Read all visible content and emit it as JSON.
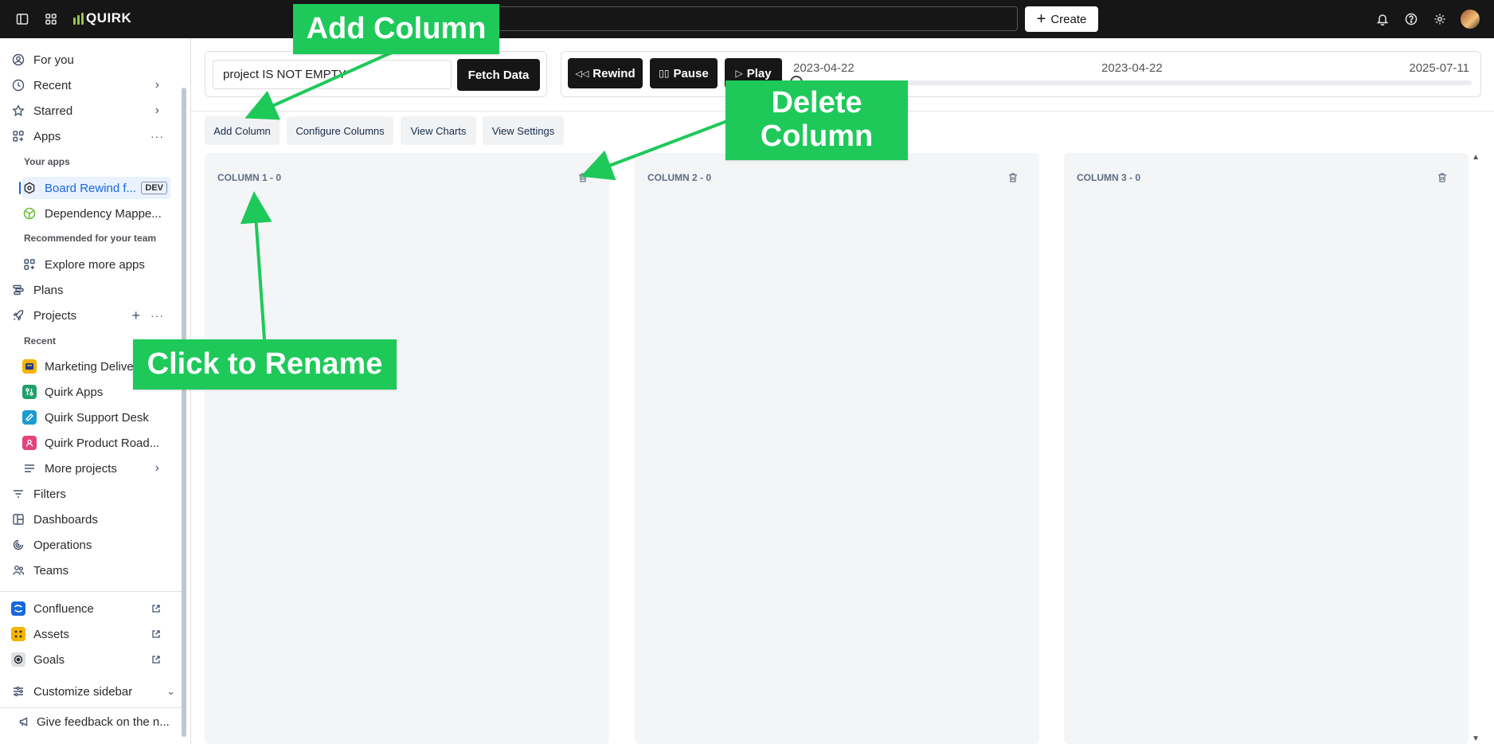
{
  "topbar": {
    "logo_text": "QUIRK",
    "create_label": "Create"
  },
  "sidebar": {
    "for_you": "For you",
    "recent": "Recent",
    "starred": "Starred",
    "apps": "Apps",
    "your_apps_heading": "Your apps",
    "app_board_rewind": "Board Rewind f...",
    "dev_badge": "DEV",
    "app_dependency": "Dependency Mappe...",
    "recommended_heading": "Recommended for your team",
    "explore_apps": "Explore more apps",
    "plans": "Plans",
    "projects": "Projects",
    "recent_heading": "Recent",
    "project_marketing": "Marketing Delive",
    "project_quirk_apps": "Quirk Apps",
    "project_support": "Quirk Support Desk",
    "project_roadmap": "Quirk Product Road...",
    "more_projects": "More projects",
    "filters": "Filters",
    "dashboards": "Dashboards",
    "operations": "Operations",
    "teams": "Teams",
    "confluence": "Confluence",
    "assets": "Assets",
    "goals": "Goals",
    "customize": "Customize sidebar",
    "feedback": "Give feedback on the n..."
  },
  "query": {
    "value": "project IS NOT EMPTY",
    "fetch_label": "Fetch Data"
  },
  "player": {
    "rewind_label": "Rewind",
    "pause_label": "Pause",
    "play_label": "Play",
    "date_current": "2023-04-22",
    "date_start": "2023-04-22",
    "date_end": "2025-07-11",
    "progress_fraction": 0.0
  },
  "toolbar": {
    "add_column": "Add Column",
    "configure_columns": "Configure Columns",
    "view_charts": "View Charts",
    "view_settings": "View Settings"
  },
  "columns": [
    {
      "title": "COLUMN 1 - 0"
    },
    {
      "title": "COLUMN 2 - 0"
    },
    {
      "title": "COLUMN 3 - 0"
    }
  ],
  "annotations": {
    "add_column": "Add Column",
    "delete_column": "Delete Column",
    "click_to_rename": "Click to Rename"
  },
  "colors": {
    "callout_green": "#1ec95a",
    "topbar_bg": "#161616",
    "accent_blue": "#1868db"
  }
}
